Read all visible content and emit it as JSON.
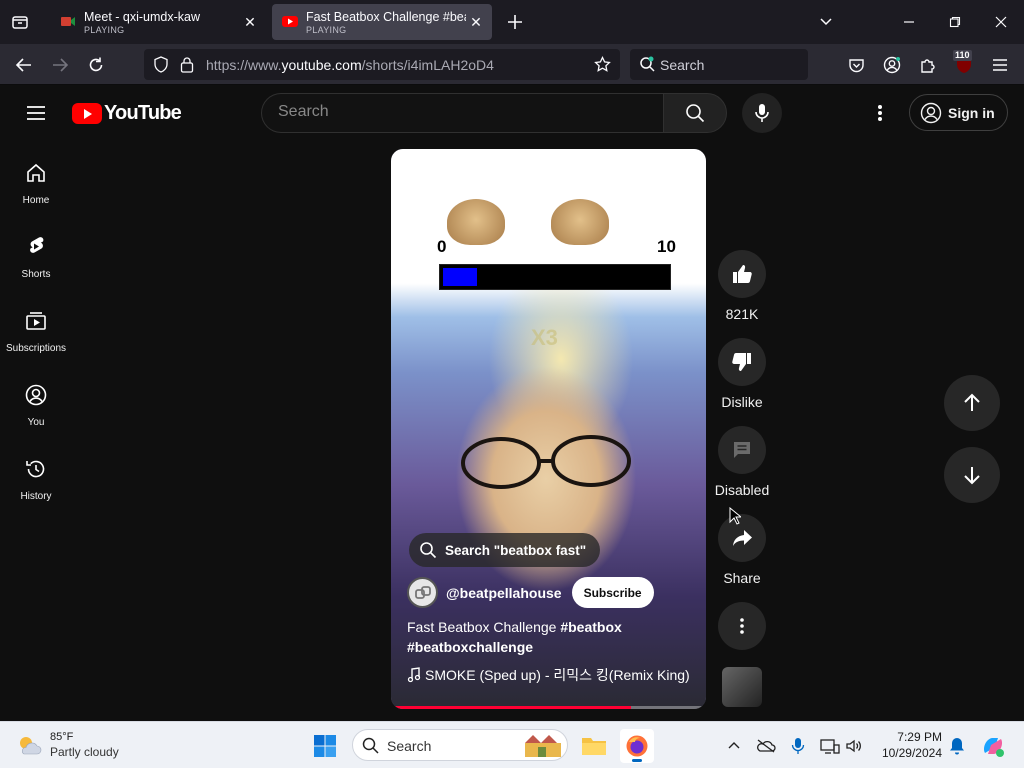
{
  "browser": {
    "tabs": [
      {
        "title": "Meet - qxi-umdx-kaw",
        "status": "PLAYING"
      },
      {
        "title": "Fast Beatbox Challenge #beatbo",
        "status": "PLAYING"
      }
    ],
    "url_prefix": "https://www.",
    "url_host": "youtube.com",
    "url_path": "/shorts/i4imLAH2oD4",
    "search_placeholder": "Search",
    "extension_badge": "110"
  },
  "youtube": {
    "logo_text": "YouTube",
    "search_placeholder": "Search",
    "sign_in_label": "Sign in",
    "guide": [
      {
        "label": "Home",
        "icon": "home-icon"
      },
      {
        "label": "Shorts",
        "icon": "shorts-icon"
      },
      {
        "label": "Subscriptions",
        "icon": "subscriptions-icon"
      },
      {
        "label": "You",
        "icon": "you-icon"
      },
      {
        "label": "History",
        "icon": "history-icon"
      }
    ],
    "short": {
      "meter_min": "0",
      "meter_max": "10",
      "meter_level": 0.15,
      "multiplier": "X3",
      "search_chip": "Search \"beatbox fast\"",
      "channel_handle": "@beatpellahouse",
      "subscribe_label": "Subscribe",
      "title_plain": "Fast Beatbox Challenge ",
      "title_tag1": "#beatbox",
      "title_tag2": "#beatboxchallenge",
      "music": "SMOKE (Sped up) - 리믹스 킹(Remix King)",
      "progress": 0.77
    },
    "actions": {
      "like_count": "821K",
      "dislike_label": "Dislike",
      "comments_label": "Disabled",
      "share_label": "Share"
    }
  },
  "taskbar": {
    "temperature": "85°F",
    "weather": "Partly cloudy",
    "search_placeholder": "Search",
    "time": "7:29 PM",
    "date": "10/29/2024"
  }
}
